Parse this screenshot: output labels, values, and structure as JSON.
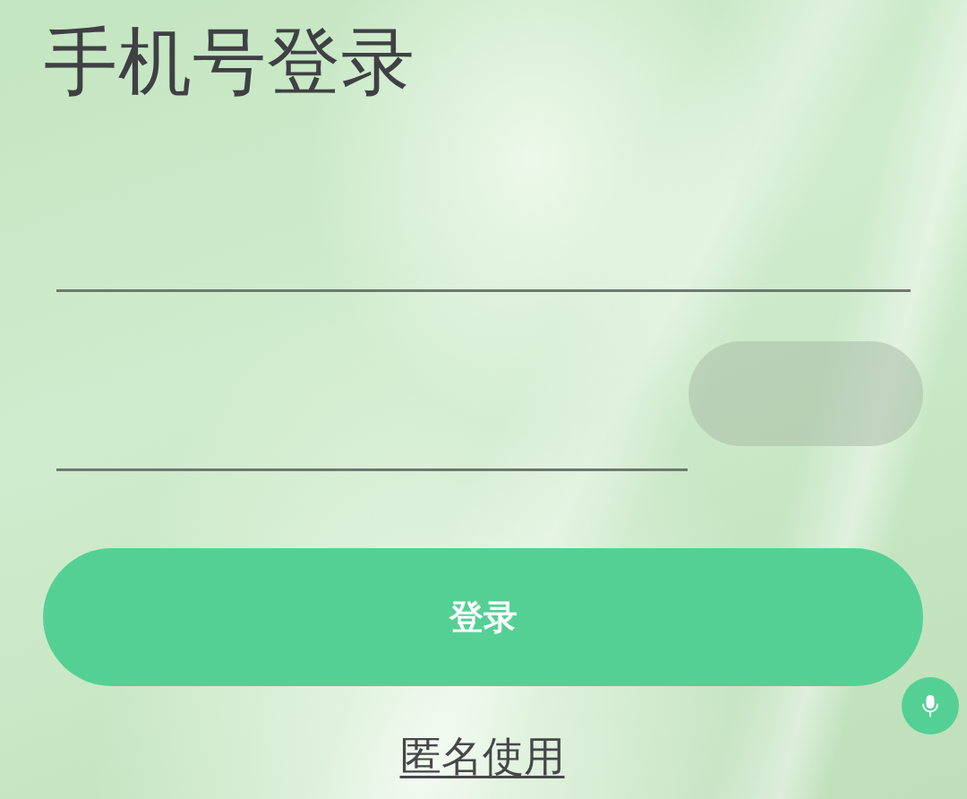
{
  "title": "手机号登录",
  "code_button": {
    "disabled": true
  },
  "login_button": {
    "label": "登录"
  },
  "anonymous_link": {
    "label": "匿名使用"
  }
}
